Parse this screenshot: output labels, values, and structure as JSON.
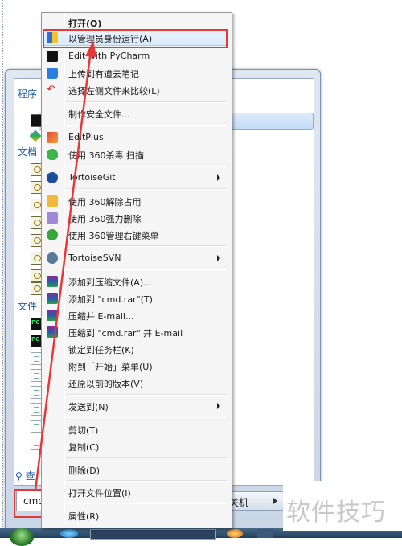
{
  "start_menu": {
    "groups": [
      {
        "title": "程序"
      },
      {
        "title": "文档"
      },
      {
        "title": "文件"
      }
    ],
    "search_more": "查",
    "search_value": "cmd",
    "shutdown_label": "关机"
  },
  "context_menu": {
    "items": [
      {
        "label": "打开(O)",
        "bold": true
      },
      {
        "label": "以管理员身份运行(A)",
        "highlighted": true
      },
      {
        "label": "Edit with PyCharm"
      },
      {
        "label": "上传到有道云笔记"
      },
      {
        "label": "选择左侧文件来比较(L)"
      },
      {
        "label": "制作安全文件..."
      },
      {
        "label": "EditPlus"
      },
      {
        "label": "使用 360杀毒 扫描"
      },
      {
        "label": "TortoiseGit",
        "submenu": true
      },
      {
        "label": "使用 360解除占用"
      },
      {
        "label": "使用 360强力删除"
      },
      {
        "label": "使用 360管理右键菜单"
      },
      {
        "label": "TortoiseSVN",
        "submenu": true
      },
      {
        "label": "添加到压缩文件(A)..."
      },
      {
        "label": "添加到 \"cmd.rar\"(T)"
      },
      {
        "label": "压缩并 E-mail..."
      },
      {
        "label": "压缩到 \"cmd.rar\" 并 E-mail"
      },
      {
        "label": "锁定到任务栏(K)"
      },
      {
        "label": "附到「开始」菜单(U)"
      },
      {
        "label": "还原以前的版本(V)"
      },
      {
        "label": "发送到(N)",
        "submenu": true
      },
      {
        "label": "剪切(T)"
      },
      {
        "label": "复制(C)"
      },
      {
        "label": "删除(D)"
      },
      {
        "label": "打开文件位置(I)"
      },
      {
        "label": "属性(R)"
      }
    ]
  },
  "watermark": "软件技巧",
  "colors": {
    "annotation_red": "#e63838",
    "menu_bg": "#f5f5f5",
    "highlight": "#d9eafc",
    "group_title": "#1d5aa8"
  }
}
